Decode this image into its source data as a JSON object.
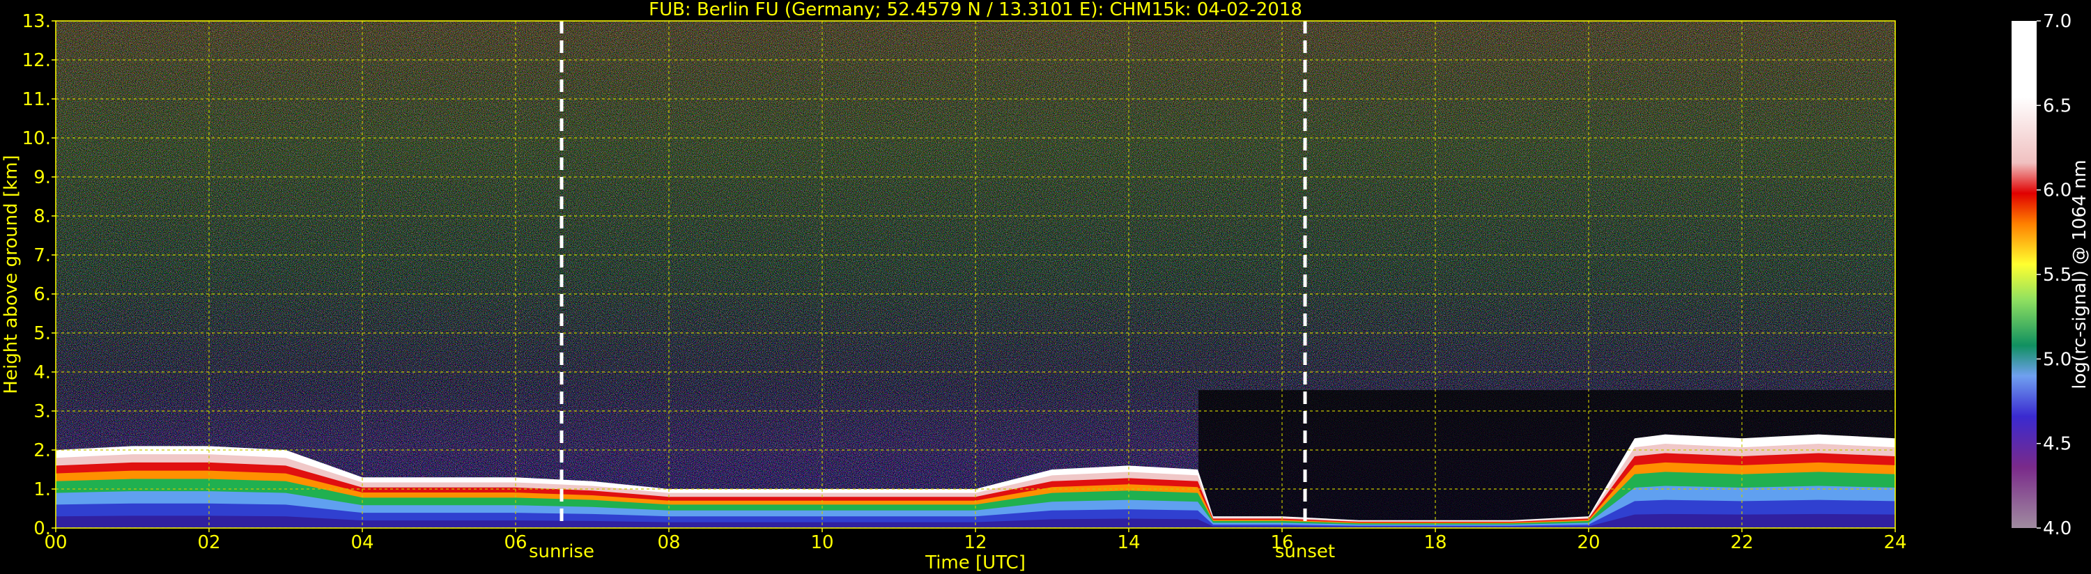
{
  "chart_data": {
    "type": "heatmap",
    "title": "FUB: Berlin FU (Germany; 52.4579 N / 13.3101 E):    CHM15k: 04-02-2018",
    "xlabel": "Time [UTC]",
    "ylabel": "Height above ground [km]",
    "xlim": [
      0,
      24
    ],
    "ylim": [
      0,
      13
    ],
    "x_ticks": [
      "00",
      "02",
      "04",
      "06",
      "08",
      "10",
      "12",
      "14",
      "16",
      "18",
      "20",
      "22",
      "24"
    ],
    "y_ticks": [
      "0.",
      "1.",
      "2.",
      "3.",
      "4.",
      "5.",
      "6.",
      "7.",
      "8.",
      "9.",
      "10.",
      "11.",
      "12.",
      "13."
    ],
    "grid": true,
    "markers": [
      {
        "label": "sunrise",
        "x": 6.6
      },
      {
        "label": "sunset",
        "x": 16.3
      }
    ],
    "colorbar": {
      "label": "log(rc-signal) @ 1064 nm",
      "range": [
        4.0,
        7.0
      ],
      "ticks": [
        "4.0",
        "4.5",
        "5.0",
        "5.5",
        "6.0",
        "6.5",
        "7.0"
      ]
    },
    "cloud_base_profile_km": [
      [
        0,
        2.0
      ],
      [
        1,
        2.1
      ],
      [
        2,
        2.1
      ],
      [
        3,
        2.0
      ],
      [
        4,
        1.3
      ],
      [
        5,
        1.3
      ],
      [
        6,
        1.3
      ],
      [
        7,
        1.2
      ],
      [
        8,
        1.0
      ],
      [
        9,
        1.0
      ],
      [
        10,
        1.0
      ],
      [
        11,
        1.0
      ],
      [
        12,
        1.0
      ],
      [
        13,
        1.5
      ],
      [
        14,
        1.6
      ],
      [
        14.9,
        1.5
      ],
      [
        15.1,
        0.3
      ],
      [
        16,
        0.3
      ],
      [
        17,
        0.2
      ],
      [
        18,
        0.2
      ],
      [
        19,
        0.2
      ],
      [
        20,
        0.3
      ],
      [
        20.6,
        2.3
      ],
      [
        21,
        2.4
      ],
      [
        22,
        2.3
      ],
      [
        23,
        2.4
      ],
      [
        24,
        2.3
      ]
    ]
  },
  "colors": {
    "background": "#000000",
    "axis_text": "#ffff00",
    "grid": "#c8c800",
    "markers": "#ffffff",
    "colorbar_stops": [
      "#a08ca0",
      "#7a2a8a",
      "#3050e0",
      "#20a060",
      "#ffd200",
      "#e00000",
      "#f0d8d8",
      "#ffffff"
    ]
  }
}
